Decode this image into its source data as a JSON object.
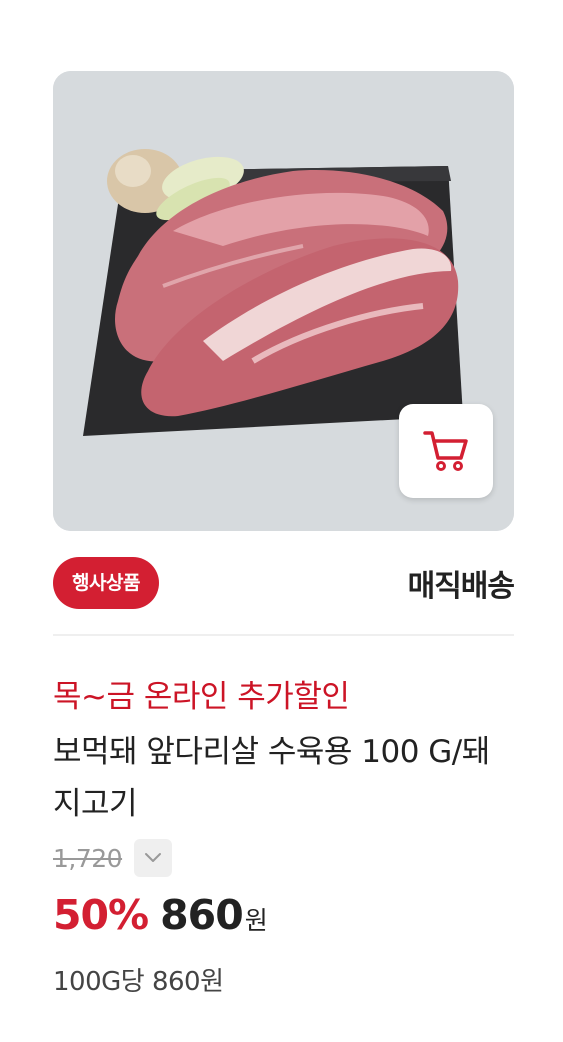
{
  "product": {
    "image_alt": "pork front leg meat on slate board",
    "badge": "행사상품",
    "delivery": "매직배송",
    "promo": "목~금 온라인 추가할인",
    "name": "보먹돼 앞다리살 수육용 100 G/돼지고기",
    "original_price": "1,720",
    "discount_rate": "50%",
    "sale_price": "860",
    "currency": "원",
    "unit_price": "100G당 860원"
  },
  "icons": {
    "cart": "cart-icon",
    "price_toggle": "chevron-down-icon"
  },
  "colors": {
    "accent": "#d31f32",
    "promo": "#cc1426",
    "image_bg": "#d6dadd"
  }
}
